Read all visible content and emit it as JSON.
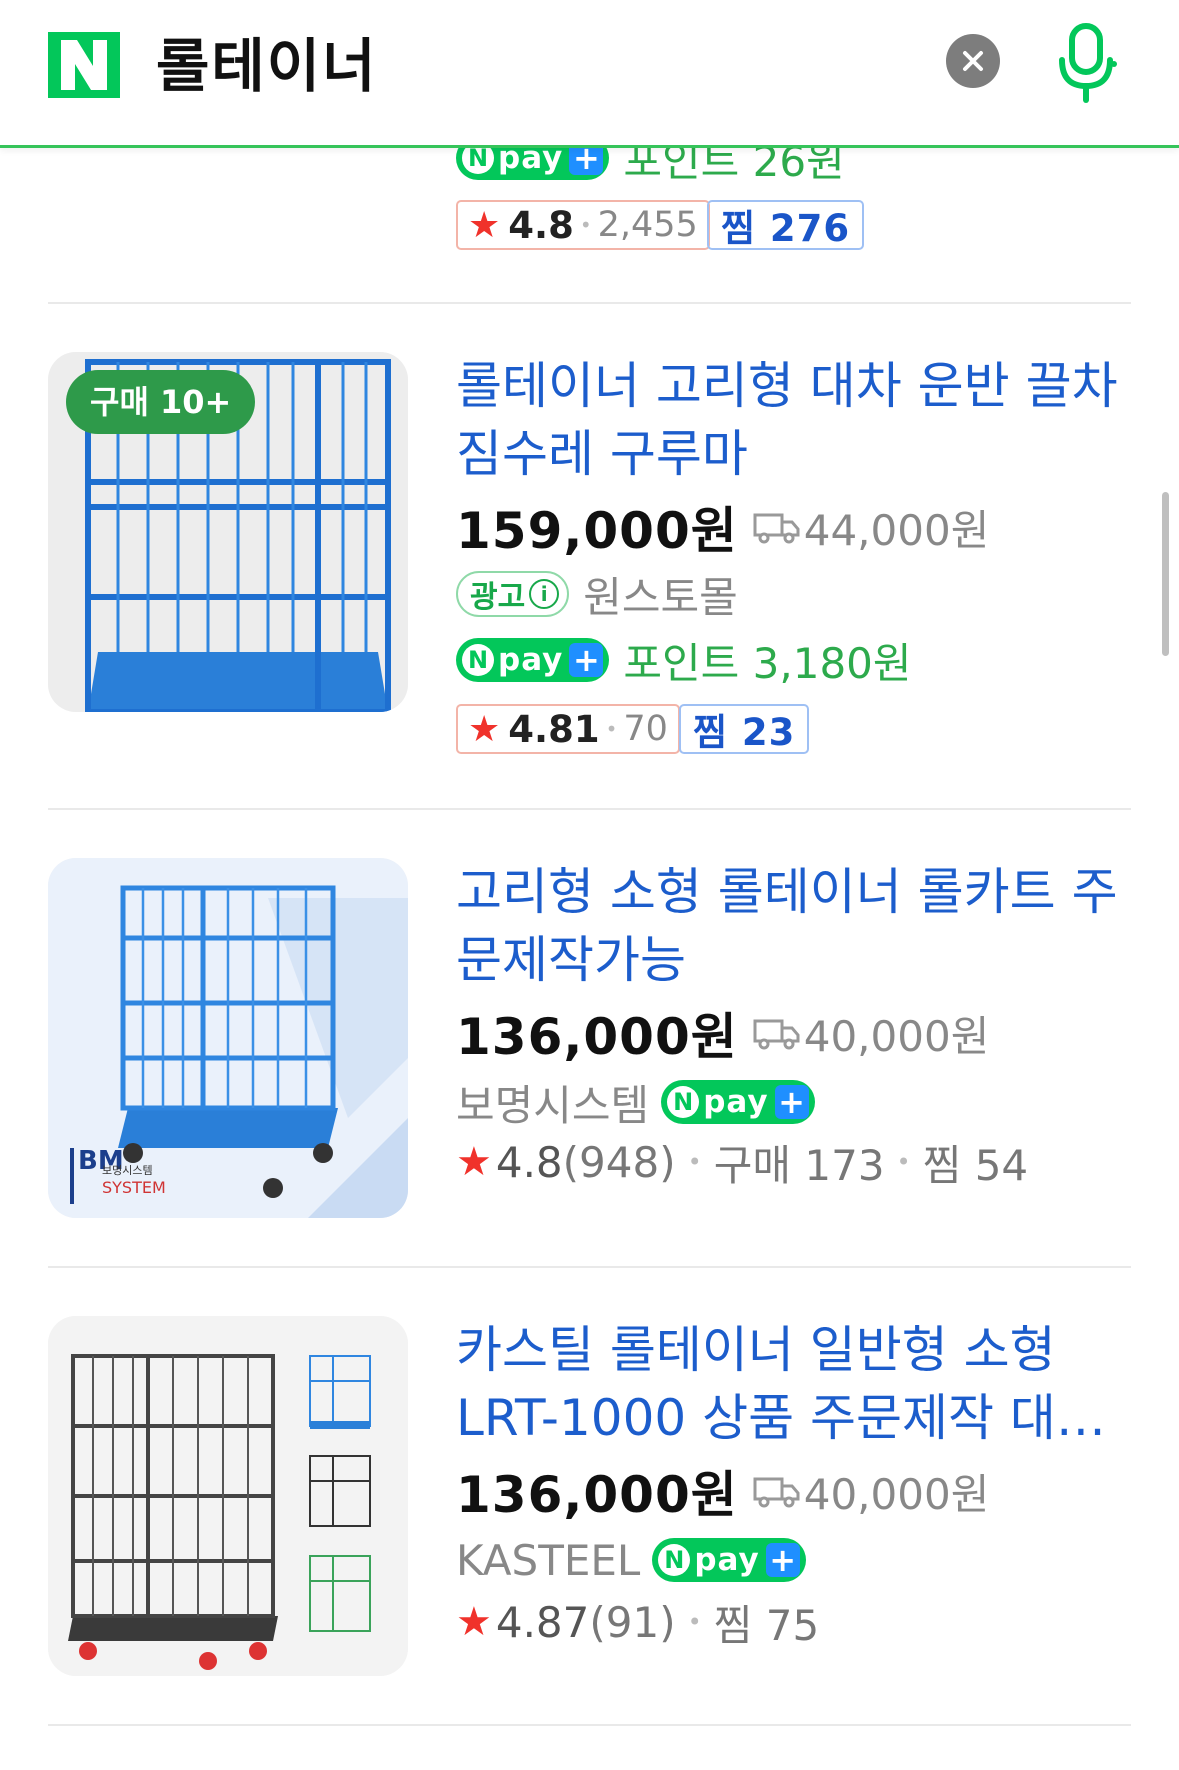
{
  "search": {
    "query": "롤테이너"
  },
  "partial_item": {
    "point_text": "포인트 26원",
    "rating": "4.8",
    "review_count": "2,455",
    "zzim": "찜 276"
  },
  "items": [
    {
      "badge": "구매 10+",
      "title": "롤테이너 고리형 대차 운반 끌차 짐수레 구루마",
      "price": "159,000원",
      "shipping": "44,000원",
      "ad_label": "광고",
      "seller": "원스토몰",
      "point_text": "포인트 3,180원",
      "rating": "4.81",
      "review_count": "70",
      "zzim": "찜 23"
    },
    {
      "title": "고리형 소형 롤테이너 롤카트 주문제작가능",
      "price": "136,000원",
      "shipping": "40,000원",
      "seller": "보명시스템",
      "rating": "4.8",
      "review_count": "(948)",
      "purchases": "구매 173",
      "zzim": "찜 54",
      "thumb_logo_text": "BM",
      "thumb_logo_sub1": "보명시스템",
      "thumb_logo_sub2": "SYSTEM"
    },
    {
      "title": "카스틸 롤테이너 일반형 소형 LRT-1000 상품 주문제작 대…",
      "price": "136,000원",
      "shipping": "40,000원",
      "seller": "KASTEEL",
      "rating": "4.87",
      "review_count": "(91)",
      "zzim": "찜 75"
    }
  ],
  "npay": {
    "n": "N",
    "word": "pay",
    "plus": "+"
  },
  "colors": {
    "brand_green": "#03c75a",
    "title_blue": "#1c5dcc",
    "star_red": "#f0322b"
  }
}
